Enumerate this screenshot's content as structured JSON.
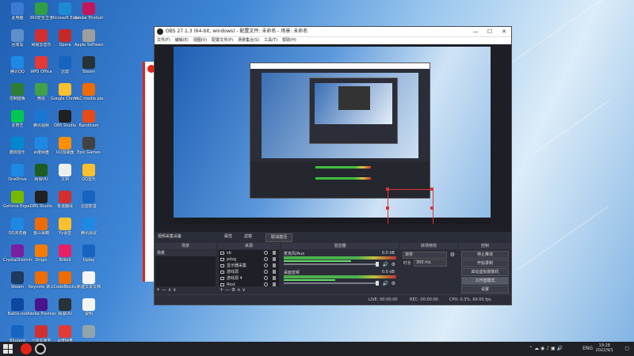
{
  "desktop": {
    "icons": [
      {
        "label": "此电脑",
        "color": "#3a7bd5"
      },
      {
        "label": "360安全卫士",
        "color": "#2f9e44"
      },
      {
        "label": "Microsoft Edge",
        "color": "#1e8ad6"
      },
      {
        "label": "Adobe Photoshop",
        "color": "#c2185b"
      },
      {
        "label": "回收站",
        "color": "#5e8fc9"
      },
      {
        "label": "网易云音乐",
        "color": "#d32f2f"
      },
      {
        "label": "Opera",
        "color": "#c62828"
      },
      {
        "label": "Apple Software Update",
        "color": "#9e9e9e"
      },
      {
        "label": "腾讯QQ",
        "color": "#1e88e5"
      },
      {
        "label": "WPS Office",
        "color": "#e53935"
      },
      {
        "label": "迅雷",
        "color": "#1565c0"
      },
      {
        "label": "Steam",
        "color": "#263238"
      },
      {
        "label": "控制面板",
        "color": "#2e7d32"
      },
      {
        "label": "微信",
        "color": "#43a047"
      },
      {
        "label": "Google Chrome",
        "color": "#fbc02d"
      },
      {
        "label": "VLC media player",
        "color": "#ef6c00"
      },
      {
        "label": "爱奇艺",
        "color": "#00c853"
      },
      {
        "label": "腾讯视频",
        "color": "#1976d2"
      },
      {
        "label": "OBS Studio",
        "color": "#212121"
      },
      {
        "label": "Bandicam",
        "color": "#e64a19"
      },
      {
        "label": "酷狗音乐",
        "color": "#0288d1"
      },
      {
        "label": "百度网盘",
        "color": "#1e88e5"
      },
      {
        "label": "UU加速器",
        "color": "#ff8f00"
      },
      {
        "label": "Epic Games",
        "color": "#424242"
      },
      {
        "label": "OneDrive",
        "color": "#1e88e5"
      },
      {
        "label": "网易UU",
        "color": "#1b5e20"
      },
      {
        "label": "文档",
        "color": "#eeeeee"
      },
      {
        "label": "QQ音乐",
        "color": "#fbc02d"
      },
      {
        "label": "Geforce Experience",
        "color": "#76b900"
      },
      {
        "label": "OBS Studio",
        "color": "#212121"
      },
      {
        "label": "有道翻译",
        "color": "#d32f2f"
      },
      {
        "label": "迅雷影音",
        "color": "#1565c0"
      },
      {
        "label": "QQ浏览器",
        "color": "#1e88e5"
      },
      {
        "label": "金山毒霸",
        "color": "#ef6c00"
      },
      {
        "label": "Yy语音",
        "color": "#fbc02d"
      },
      {
        "label": "腾讯会议",
        "color": "#1e88e5"
      },
      {
        "label": "CrystalDiskInfo",
        "color": "#7b1fa2"
      },
      {
        "label": "Origin",
        "color": "#f57c00"
      },
      {
        "label": "Bilibili",
        "color": "#e91e63"
      },
      {
        "label": "Uplay",
        "color": "#1565c0"
      },
      {
        "label": "Steam",
        "color": "#1e3a5f"
      },
      {
        "label": "Keynote 讲义",
        "color": "#ef6c00"
      },
      {
        "label": "CodeBlocks",
        "color": "#ef6c00"
      },
      {
        "label": "新建文本文档",
        "color": "#f5f5f5"
      },
      {
        "label": "Battle.net",
        "color": "#0d47a1"
      },
      {
        "label": "Adobe Premiere",
        "color": "#4a148c"
      },
      {
        "label": "网易UU",
        "color": "#263238"
      },
      {
        "label": "说明",
        "color": "#f5f5f5"
      },
      {
        "label": "Blizzard",
        "color": "#1565c0"
      },
      {
        "label": "小米云服务",
        "color": "#d32f2f"
      },
      {
        "label": "百度网盘",
        "color": "#e53935"
      },
      {
        "label": "",
        "color": "#90a4ae"
      }
    ]
  },
  "obs": {
    "title": "OBS 27.1.3 (64-bit, windows) - 配置文件: 未命名 - 场景: 未命名",
    "window_buttons": [
      "—",
      "☐",
      "✕"
    ],
    "menu": [
      "文件(F)",
      "编辑(E)",
      "视图(V)",
      "配置文件(P)",
      "场景集合(S)",
      "工具(T)",
      "帮助(H)"
    ],
    "toolbar": {
      "source_title": "视频采集设备",
      "properties": "属性",
      "filters": "滤镜",
      "deactivate": "取消激活"
    },
    "docks": {
      "scenes": {
        "header": "场景",
        "items": [
          "场景"
        ],
        "footer": "+  —  ∧  ∨"
      },
      "sources": {
        "header": "来源",
        "items": [
          "sb",
          "pdzg",
          "显示器采集",
          "游戏源",
          "游戏源 4",
          "Rost"
        ],
        "footer": "+  —  ⚙  ∧  ∨"
      },
      "mixer": {
        "header": "混音器",
        "channels": [
          {
            "name": "麦克风/Aux",
            "db": "0.0 dB",
            "level": 0.72
          },
          {
            "name": "桌面音频",
            "db": "0.0 dB",
            "level": 0.55
          }
        ]
      },
      "transitions": {
        "header": "转场特效",
        "type": "渐变",
        "duration_label": "时长",
        "duration": "300 ms"
      },
      "controls": {
        "header": "控制",
        "buttons": [
          "停止推流",
          "开始录制",
          "启动虚拟摄像机",
          "工作室模式",
          "设置",
          "退出"
        ],
        "highlighted": 3
      }
    },
    "status": {
      "live": "LIVE: 00:00:00",
      "rec": "REC: 00:00:00",
      "cpu": "CPU: 0.3%, 60.00 fps"
    }
  },
  "taskbar": {
    "tray_lang": "ENG",
    "time": "19:28",
    "date": "2022/9/1"
  }
}
